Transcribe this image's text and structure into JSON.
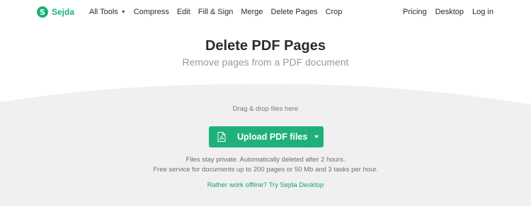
{
  "brand": {
    "name": "Sejda",
    "mark": "S",
    "color": "#18b075"
  },
  "nav": {
    "left": [
      {
        "label": "All Tools",
        "dropdown": true
      },
      {
        "label": "Compress"
      },
      {
        "label": "Edit"
      },
      {
        "label": "Fill & Sign"
      },
      {
        "label": "Merge"
      },
      {
        "label": "Delete Pages"
      },
      {
        "label": "Crop"
      }
    ],
    "right": [
      {
        "label": "Pricing"
      },
      {
        "label": "Desktop"
      },
      {
        "label": "Log in"
      }
    ]
  },
  "hero": {
    "title": "Delete PDF Pages",
    "subtitle": "Remove pages from a PDF document"
  },
  "upload": {
    "drag_text": "Drag & drop files here",
    "button_label": "Upload PDF files",
    "button_icon": "pdf-file-icon",
    "dropdown_icon": "caret-down-icon",
    "color": "#1fb17a"
  },
  "info": {
    "line1": "Files stay private. Automatically deleted after 2 hours.",
    "line2": "Free service for documents up to 200 pages or 50 Mb and 3 tasks per hour."
  },
  "offline": {
    "text": "Rather work offline? Try Sejda Desktop",
    "color": "#1a9e6c"
  }
}
